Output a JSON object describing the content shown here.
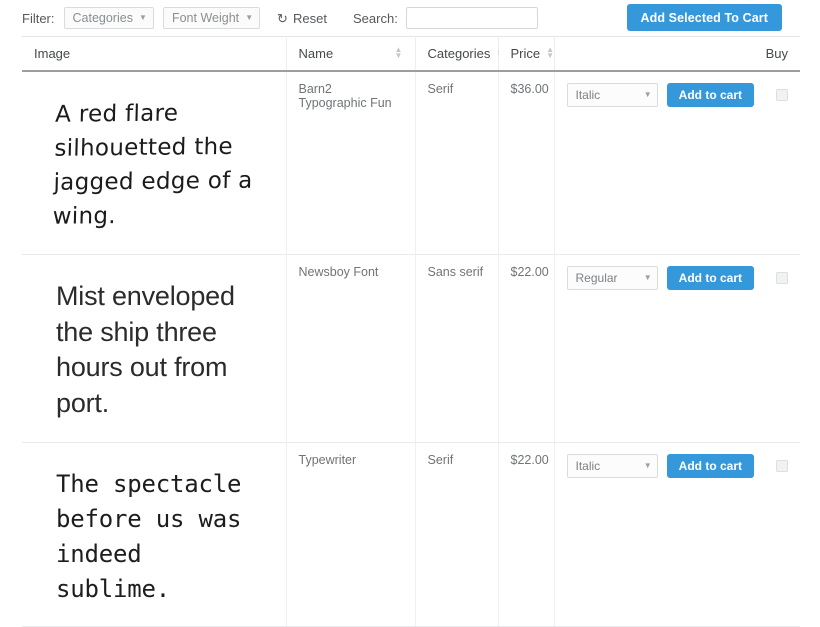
{
  "toolbar": {
    "filter_label": "Filter:",
    "filters": [
      {
        "name": "categories",
        "value": "Categories"
      },
      {
        "name": "font-weight",
        "value": "Font Weight"
      }
    ],
    "reset_label": "Reset",
    "reset_icon": "↺",
    "search_label": "Search:",
    "search_value": "",
    "search_placeholder": "",
    "add_selected_label": "Add Selected To Cart",
    "accent_color": "#3498db"
  },
  "table": {
    "columns": [
      {
        "label": "Image",
        "sortable": false,
        "align": "left"
      },
      {
        "label": "Name",
        "sortable": true,
        "align": "left"
      },
      {
        "label": "Categories",
        "sortable": true,
        "align": "left"
      },
      {
        "label": "Price",
        "sortable": true,
        "align": "left"
      },
      {
        "label": "Buy",
        "sortable": false,
        "align": "right"
      }
    ],
    "add_to_cart_label": "Add to cart",
    "rows": [
      {
        "specimen_text": "A red flare silhouetted the jagged edge of a wing.",
        "name": "Barn2 Typographic Fun",
        "categories": "Serif",
        "price": "$36.00",
        "weight": "Italic",
        "selected": false
      },
      {
        "specimen_text": "Mist enveloped the ship three hours out from port.",
        "name": "Newsboy Font",
        "categories": "Sans serif",
        "price": "$22.00",
        "weight": "Regular",
        "selected": false
      },
      {
        "specimen_text": "The spectacle before us was indeed sublime.",
        "name": "Typewriter",
        "categories": "Serif",
        "price": "$22.00",
        "weight": "Italic",
        "selected": false
      }
    ]
  }
}
